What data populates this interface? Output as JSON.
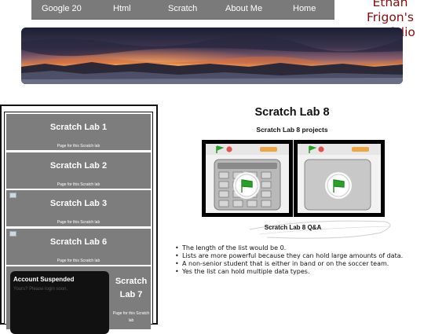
{
  "nav": {
    "items": [
      "Google 20",
      "Html",
      "Scratch",
      "About Me",
      "Home"
    ]
  },
  "brand": {
    "line1": "Ethan",
    "line2": "Frigon's",
    "line3": "Portfolio"
  },
  "sidebar": {
    "cards": [
      {
        "title": "Scratch Lab 1",
        "subtitle": "Page for this Scratch lab"
      },
      {
        "title": "Scratch Lab 2",
        "subtitle": "Page for this Scratch lab"
      },
      {
        "title": "Scratch Lab 3",
        "subtitle": "Page for this Scratch lab"
      },
      {
        "title": "Scratch Lab 6",
        "subtitle": "Page for this Scratch lab"
      },
      {
        "title_line1": "Scratch",
        "title_line2": "Lab 7",
        "subtitle_line1": "Page for this Scratch",
        "subtitle_line2": "lab"
      }
    ],
    "suspended": {
      "title": "Account Suspended",
      "subtitle": "Yours? Please login soon."
    }
  },
  "main": {
    "title": "Scratch Lab 8",
    "subtitle": "Scratch Lab 8 projects",
    "qa_label": "Scratch Lab 8 Q&A",
    "answers": [
      "The length of the list would be 0.",
      "Lists are more powerful because they can hold large amounts of data.",
      "A non-senior student that is either in band or on the soccer team.",
      "Yes the list can hold multiple data types."
    ]
  },
  "colors": {
    "nav_bg": "#7a7a7a",
    "brand": "#8b0a0a",
    "card_bg": "#7d7d7d",
    "scratch_flag": "#2aa02a"
  }
}
